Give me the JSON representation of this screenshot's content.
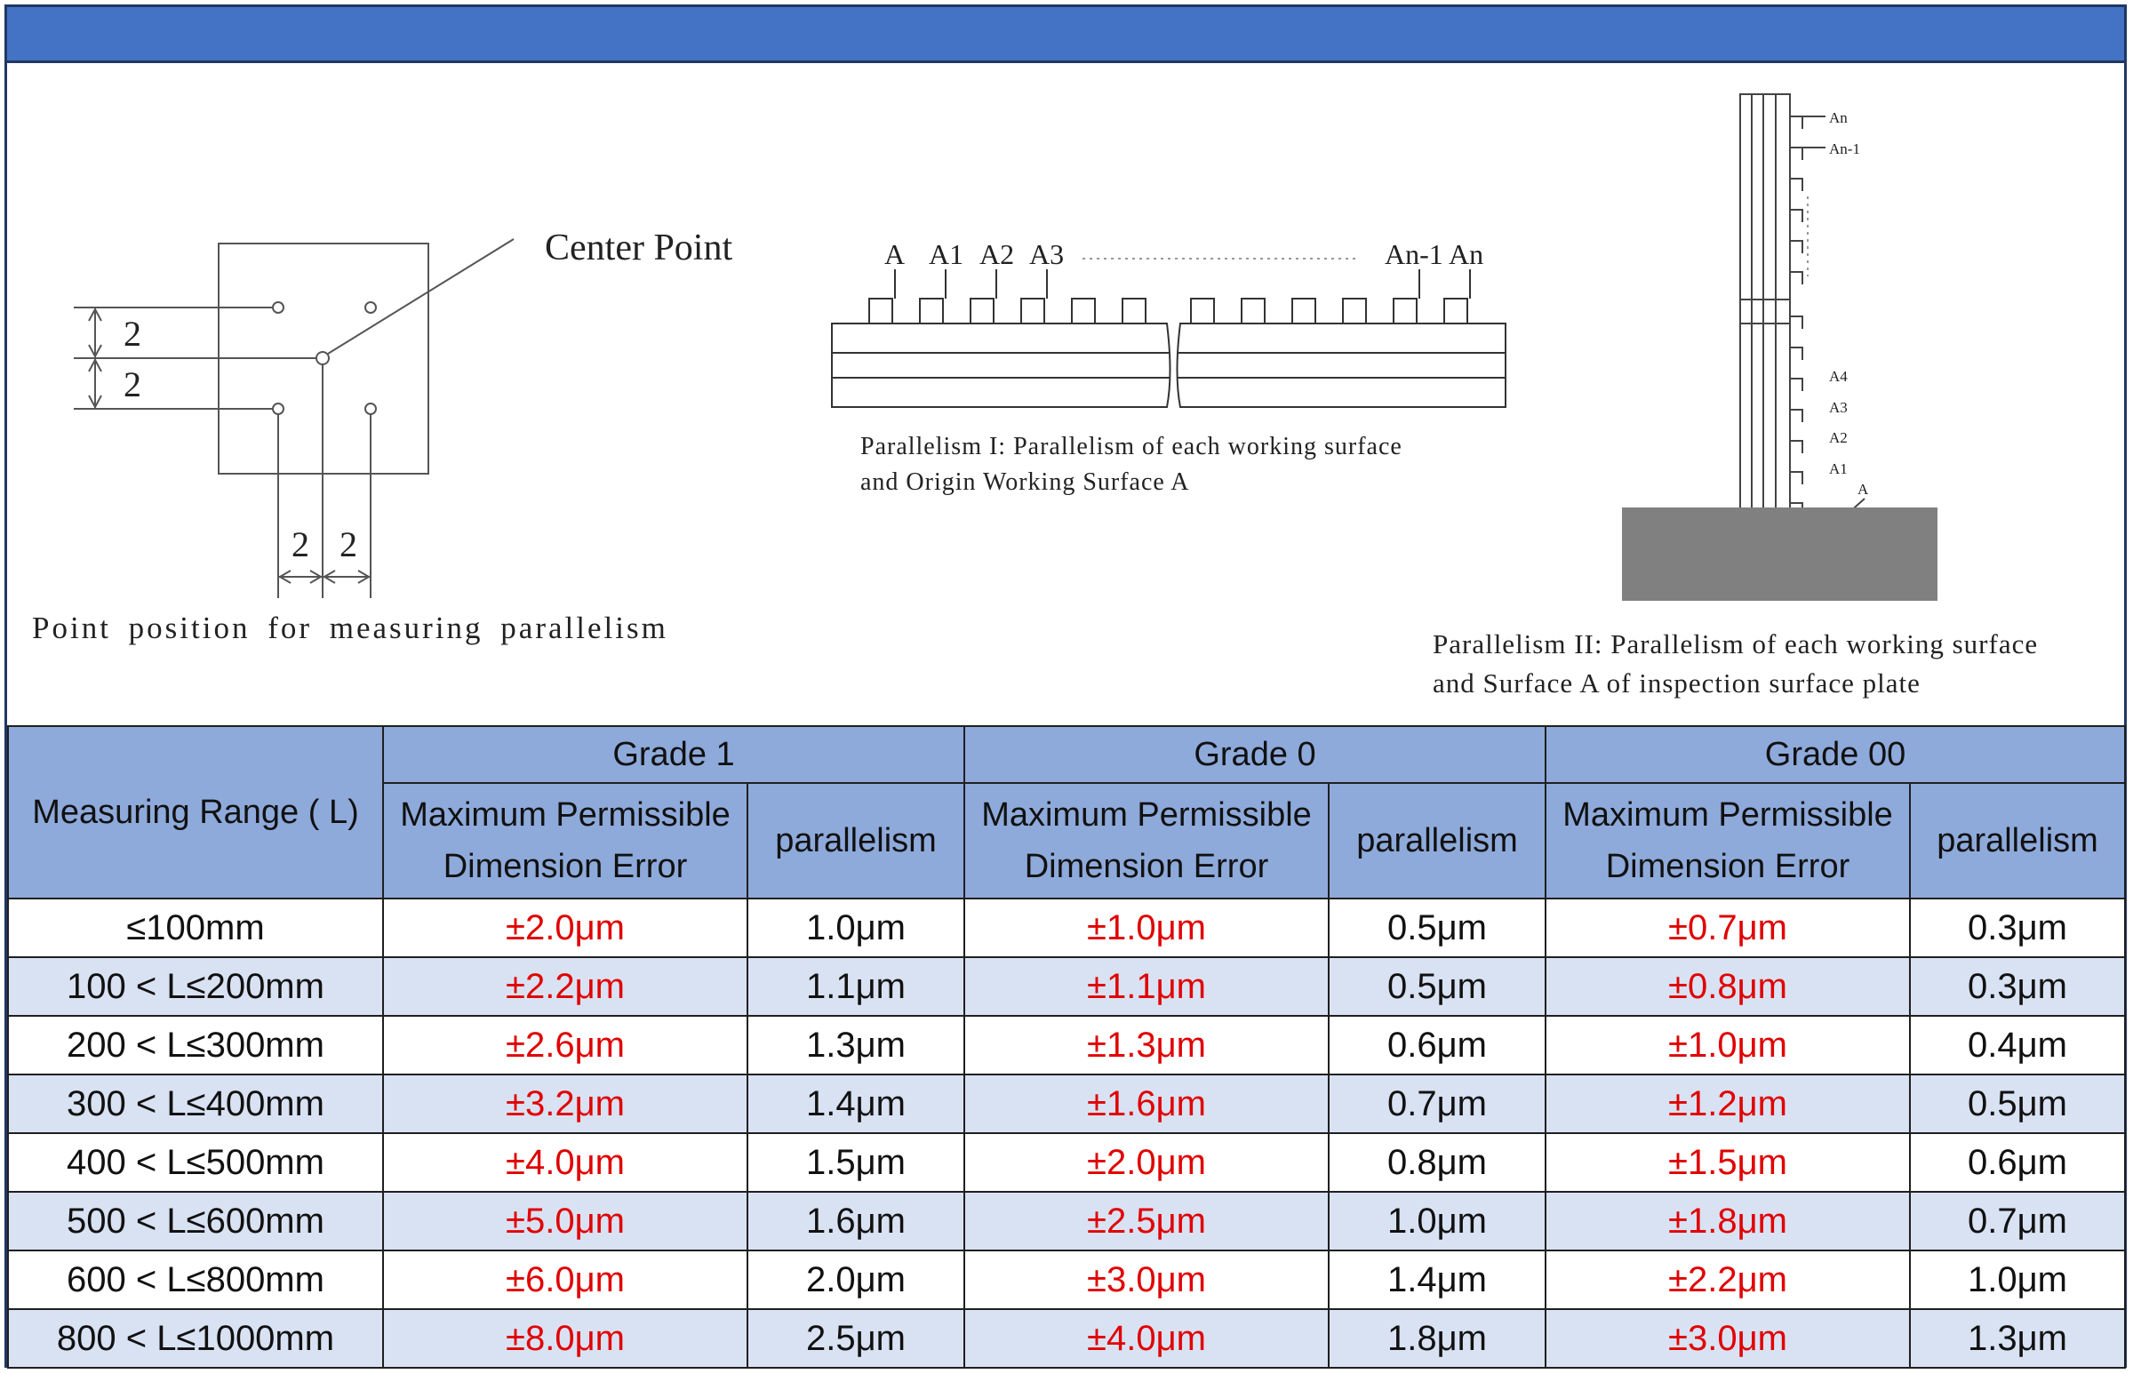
{
  "title": "",
  "diagram_left": {
    "label_center": "Center Point",
    "dim_2_a": "2",
    "dim_2_b": "2",
    "dim_2_c": "2",
    "dim_2_d": "2",
    "caption": "Point position for measuring parallelism"
  },
  "diagram_mid": {
    "labels": [
      "A",
      "A1",
      "A2",
      "A3",
      "An-1",
      "An"
    ],
    "caption_line1": "Parallelism I: Parallelism of each working surface",
    "caption_line2": "and Origin Working Surface A"
  },
  "diagram_right": {
    "top_labels": [
      "An",
      "An-1"
    ],
    "bottom_labels": [
      "A4",
      "A3",
      "A2",
      "A1",
      "A"
    ],
    "caption_line1": "Parallelism II: Parallelism of each working surface",
    "caption_line2": "and Surface A of inspection surface plate"
  },
  "table": {
    "range_header": "Measuring Range ( L)",
    "grades": [
      "Grade 1",
      "Grade 0",
      "Grade 00"
    ],
    "sub_error": "Maximum Permissible Dimension Error",
    "sub_parallelism": "parallelism",
    "rows": [
      {
        "range": "≤100mm",
        "g1_err": "±2.0μm",
        "g1_par": "1.0μm",
        "g0_err": "±1.0μm",
        "g0_par": "0.5μm",
        "g00_err": "±0.7μm",
        "g00_par": "0.3μm"
      },
      {
        "range": "100 < L≤200mm",
        "g1_err": "±2.2μm",
        "g1_par": "1.1μm",
        "g0_err": "±1.1μm",
        "g0_par": "0.5μm",
        "g00_err": "±0.8μm",
        "g00_par": "0.3μm"
      },
      {
        "range": "200 < L≤300mm",
        "g1_err": "±2.6μm",
        "g1_par": "1.3μm",
        "g0_err": "±1.3μm",
        "g0_par": "0.6μm",
        "g00_err": "±1.0μm",
        "g00_par": "0.4μm"
      },
      {
        "range": "300 < L≤400mm",
        "g1_err": "±3.2μm",
        "g1_par": "1.4μm",
        "g0_err": "±1.6μm",
        "g0_par": "0.7μm",
        "g00_err": "±1.2μm",
        "g00_par": "0.5μm"
      },
      {
        "range": "400 < L≤500mm",
        "g1_err": "±4.0μm",
        "g1_par": "1.5μm",
        "g0_err": "±2.0μm",
        "g0_par": "0.8μm",
        "g00_err": "±1.5μm",
        "g00_par": "0.6μm"
      },
      {
        "range": "500 < L≤600mm",
        "g1_err": "±5.0μm",
        "g1_par": "1.6μm",
        "g0_err": "±2.5μm",
        "g0_par": "1.0μm",
        "g00_err": "±1.8μm",
        "g00_par": "0.7μm"
      },
      {
        "range": "600 < L≤800mm",
        "g1_err": "±6.0μm",
        "g1_par": "2.0μm",
        "g0_err": "±3.0μm",
        "g0_par": "1.4μm",
        "g00_err": "±2.2μm",
        "g00_par": "1.0μm"
      },
      {
        "range": "800 < L≤1000mm",
        "g1_err": "±8.0μm",
        "g1_par": "2.5μm",
        "g0_err": "±4.0μm",
        "g0_par": "1.8μm",
        "g00_err": "±3.0μm",
        "g00_par": "1.3μm"
      }
    ]
  },
  "colors": {
    "title_bar": "#4472c4",
    "header_bg": "#8eaadb",
    "alt_row_bg": "#d9e2f3",
    "error_text": "#e00000",
    "plate": "#808080"
  }
}
